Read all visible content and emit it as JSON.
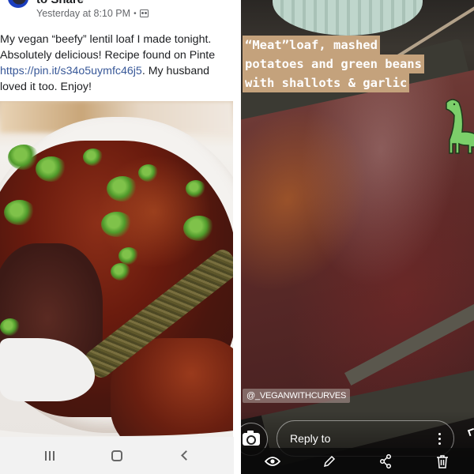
{
  "facebook_post": {
    "author_name": "to Share",
    "timestamp": "Yesterday at 8:10 PM",
    "separator": "•",
    "audience_icon": "friends-icon",
    "body": {
      "line1": "My vegan “beefy” lentil loaf I made tonight.",
      "line2": "Absolutely delicious! Recipe found on Pinte",
      "line3_link": "https://pin.it/s34o5uymfc46j5",
      "line3_rest": ". My husband",
      "line4": "loved it too. Enjoy!"
    },
    "photo_alt": "Vegan lentil loaf with glaze and parsley in a white baking dish"
  },
  "android_nav": {
    "buttons": [
      {
        "name": "recents",
        "icon": "recents-icon"
      },
      {
        "name": "home",
        "icon": "home-icon"
      },
      {
        "name": "back",
        "icon": "back-icon"
      }
    ]
  },
  "instagram_story": {
    "caption_lines": [
      "“Meat”loaf, mashed",
      "potatoes and green beans",
      "with shallots & garlic"
    ],
    "caption_bg_color": "#c4a27c",
    "sticker": "dinosaur-sticker",
    "mention": "@_VEGANWITHCURVES",
    "reply_placeholder": "Reply to",
    "actions": [
      {
        "name": "viewers",
        "icon": "eye-icon"
      },
      {
        "name": "edit",
        "icon": "pencil-icon"
      },
      {
        "name": "share",
        "icon": "share-icon"
      },
      {
        "name": "delete",
        "icon": "trash-icon"
      }
    ]
  }
}
